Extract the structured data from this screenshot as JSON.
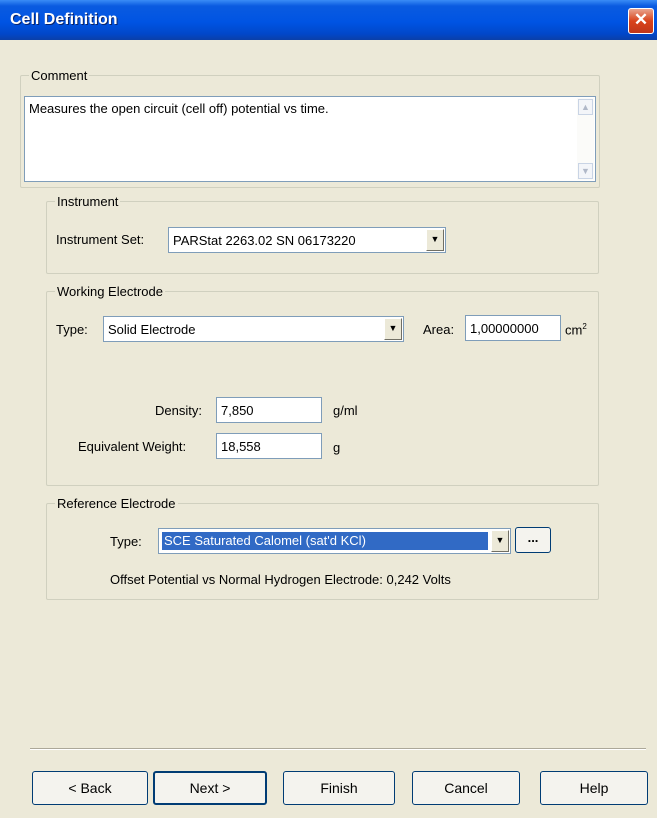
{
  "window": {
    "title": "Cell Definition",
    "close_symbol": "✕"
  },
  "comment": {
    "legend": "Comment",
    "text": "Measures the open circuit (cell off) potential vs time."
  },
  "instrument": {
    "legend": "Instrument",
    "set_label": "Instrument Set:",
    "set_value": "PARStat 2263.02 SN 06173220"
  },
  "working_electrode": {
    "legend": "Working Electrode",
    "type_label": "Type:",
    "type_value": "Solid Electrode",
    "area_label": "Area:",
    "area_value": "1,00000000",
    "area_unit": "cm",
    "area_unit_sup": "2",
    "density_label": "Density:",
    "density_value": "7,850",
    "density_unit": "g/ml",
    "eq_weight_label": "Equivalent Weight:",
    "eq_weight_value": "18,558",
    "eq_weight_unit": "g"
  },
  "reference_electrode": {
    "legend": "Reference Electrode",
    "type_label": "Type:",
    "type_value": "SCE Saturated Calomel (sat'd KCl)",
    "more_label": "...",
    "offset_text": "Offset Potential vs Normal Hydrogen Electrode:  0,242 Volts"
  },
  "buttons": {
    "back": "< Back",
    "next": "Next >",
    "finish": "Finish",
    "cancel": "Cancel",
    "help": "Help"
  },
  "icons": {
    "dropdown": "chevron-down-icon",
    "scroll_up": "scroll-up-icon",
    "scroll_down": "scroll-down-icon",
    "close": "close-icon"
  }
}
